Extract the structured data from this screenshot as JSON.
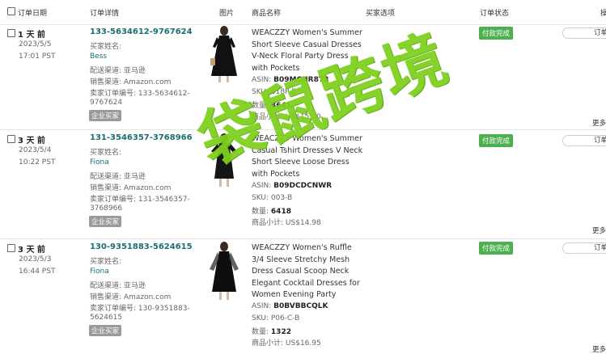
{
  "header": {
    "order_date": "订单日期",
    "order_detail": "订单详情",
    "image": "图片",
    "product_name": "商品名称",
    "buyer_options": "买家选项",
    "order_status": "订单状态",
    "action": "操"
  },
  "labels": {
    "buyer_name": "买家姓名:",
    "channel": "配送渠道: 亚马逊",
    "sales_channel": "销售渠道: Amazon.com",
    "seller_order_no": "卖家订单编号:",
    "business_buyer": "企业买家",
    "asin": "ASIN:",
    "sku": "SKU:",
    "qty": "数量:",
    "subtotal": "商品小计:",
    "status": "付款完成",
    "order_btn": "订单",
    "more": "更多"
  },
  "orders": [
    {
      "days": "1 天 前",
      "date": "2023/5/5",
      "time": "17:01 PST",
      "order_id": "133-5634612-9767624",
      "buyer": "Bess",
      "seller_no_1": "133-5634612-",
      "seller_no_2": "9767624",
      "title": "WEACZZY Women's Summer Short Sleeve Casual Dresses V-Neck Floral Party Dress with Pockets",
      "asin": "B09MCNR8T8",
      "sku": "018P-B",
      "qty": "3641",
      "subtotal": "US$15.70"
    },
    {
      "days": "3 天 前",
      "date": "2023/5/4",
      "time": "10:22 PST",
      "order_id": "131-3546357-3768966",
      "buyer": "Fiona",
      "seller_no_1": "131-3546357-",
      "seller_no_2": "3768966",
      "title": "WEACZZY Women's Summer Casual Tshirt Dresses V Neck Short Sleeve Loose Dress with Pockets",
      "asin": "B09DCDCNWR",
      "sku": "003-B",
      "qty": "6418",
      "subtotal": "US$14.98"
    },
    {
      "days": "3 天 前",
      "date": "2023/5/3",
      "time": "16:44 PST",
      "order_id": "130-9351883-5624615",
      "buyer": "Fiona",
      "seller_no_1": "130-9351883-",
      "seller_no_2": "5624615",
      "title": "WEACZZY Women's Ruffle 3/4 Sleeve Stretchy Mesh Dress Casual Scoop Neck Elegant Cocktail Dresses for Women Evening Party",
      "asin": "B0BVBBCQLK",
      "sku": "P06-C-B",
      "qty": "1322",
      "subtotal": "US$16.95"
    }
  ],
  "watermark": "袋鼠跨境",
  "colors": {
    "teal": "#1b6e70",
    "status_green": "#4caf50",
    "watermark": "#7fd11f"
  }
}
